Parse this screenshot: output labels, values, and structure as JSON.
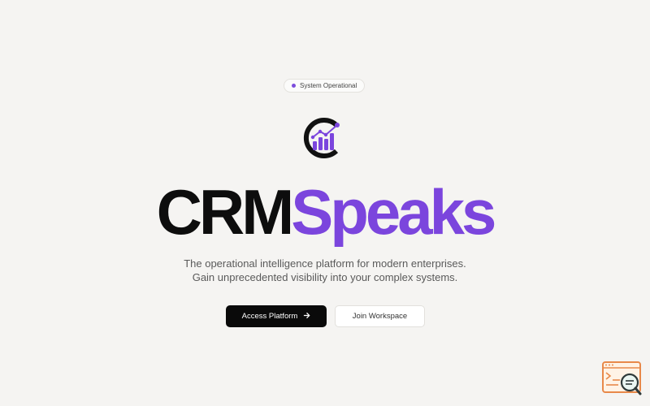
{
  "status": {
    "label": "System Operational",
    "dot_color": "#7c4ddc"
  },
  "brand": {
    "part1": "CRM",
    "part2": "Speaks",
    "accent_color": "#7b45dd",
    "logo_icon": "crm-speaks-logo"
  },
  "tagline": {
    "line1": "The operational intelligence platform for modern enterprises.",
    "line2": "Gain unprecedented visibility into your complex systems."
  },
  "actions": {
    "primary_label": "Access Platform",
    "primary_icon": "arrow-right-icon",
    "secondary_label": "Join Workspace"
  },
  "widget": {
    "icon": "terminal-search-icon"
  }
}
